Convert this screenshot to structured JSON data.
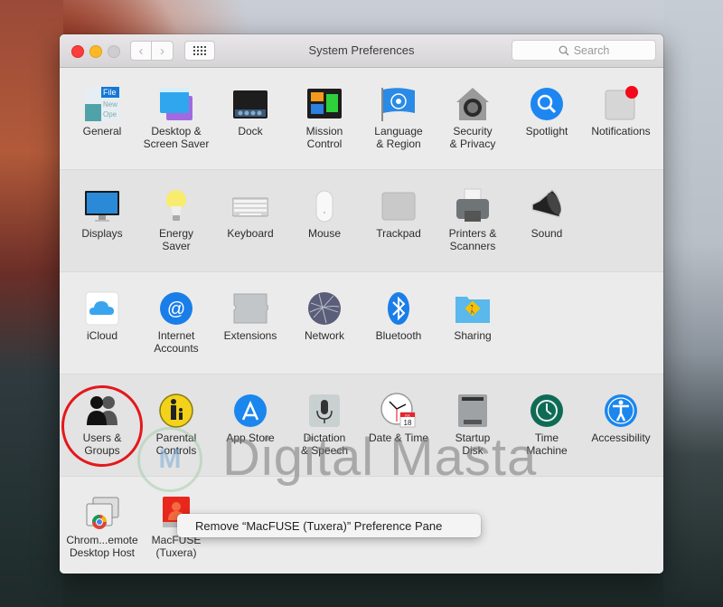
{
  "window": {
    "title": "System Preferences",
    "search_placeholder": "Search"
  },
  "sections": [
    {
      "panes": [
        {
          "label": "General",
          "icon": "general-icon"
        },
        {
          "label": "Desktop &\nScreen Saver",
          "icon": "desktop-screensaver-icon"
        },
        {
          "label": "Dock",
          "icon": "dock-icon"
        },
        {
          "label": "Mission\nControl",
          "icon": "mission-control-icon"
        },
        {
          "label": "Language\n& Region",
          "icon": "un-flag-icon"
        },
        {
          "label": "Security\n& Privacy",
          "icon": "security-house-icon"
        },
        {
          "label": "Spotlight",
          "icon": "magnifier-icon"
        },
        {
          "label": "Notifications",
          "icon": "notifications-icon"
        }
      ]
    },
    {
      "panes": [
        {
          "label": "Displays",
          "icon": "monitor-icon"
        },
        {
          "label": "Energy\nSaver",
          "icon": "lightbulb-icon"
        },
        {
          "label": "Keyboard",
          "icon": "keyboard-icon"
        },
        {
          "label": "Mouse",
          "icon": "mouse-icon"
        },
        {
          "label": "Trackpad",
          "icon": "trackpad-icon"
        },
        {
          "label": "Printers &\nScanners",
          "icon": "printer-icon"
        },
        {
          "label": "Sound",
          "icon": "speaker-icon"
        }
      ]
    },
    {
      "panes": [
        {
          "label": "iCloud",
          "icon": "cloud-icon"
        },
        {
          "label": "Internet\nAccounts",
          "icon": "at-sign-icon"
        },
        {
          "label": "Extensions",
          "icon": "puzzle-icon"
        },
        {
          "label": "Network",
          "icon": "globe-icon"
        },
        {
          "label": "Bluetooth",
          "icon": "bluetooth-icon"
        },
        {
          "label": "Sharing",
          "icon": "sharing-folder-icon"
        }
      ]
    },
    {
      "panes": [
        {
          "label": "Users &\nGroups",
          "icon": "users-icon"
        },
        {
          "label": "Parental\nControls",
          "icon": "parental-icon"
        },
        {
          "label": "App Store",
          "icon": "app-store-icon"
        },
        {
          "label": "Dictation\n& Speech",
          "icon": "microphone-icon"
        },
        {
          "label": "Date & Time",
          "icon": "clock-calendar-icon"
        },
        {
          "label": "Startup\nDisk",
          "icon": "hard-disk-icon"
        },
        {
          "label": "Time\nMachine",
          "icon": "time-machine-icon"
        },
        {
          "label": "Accessibility",
          "icon": "accessibility-icon"
        }
      ]
    },
    {
      "panes": [
        {
          "label": "Chrom...emote\nDesktop Host",
          "icon": "chrome-remote-icon"
        },
        {
          "label": "MacFUSE\n(Tuxera)",
          "icon": "macfuse-icon"
        }
      ]
    }
  ],
  "calendar_badge": {
    "month": "JUL",
    "day": "18"
  },
  "context_menu": {
    "item": "Remove “MacFUSE (Tuxera)” Preference Pane"
  },
  "watermark": {
    "text": "Digital Masta",
    "logo": "M"
  },
  "annotation": {
    "highlighted_pane": "Users & Groups",
    "color": "#e3181c"
  }
}
